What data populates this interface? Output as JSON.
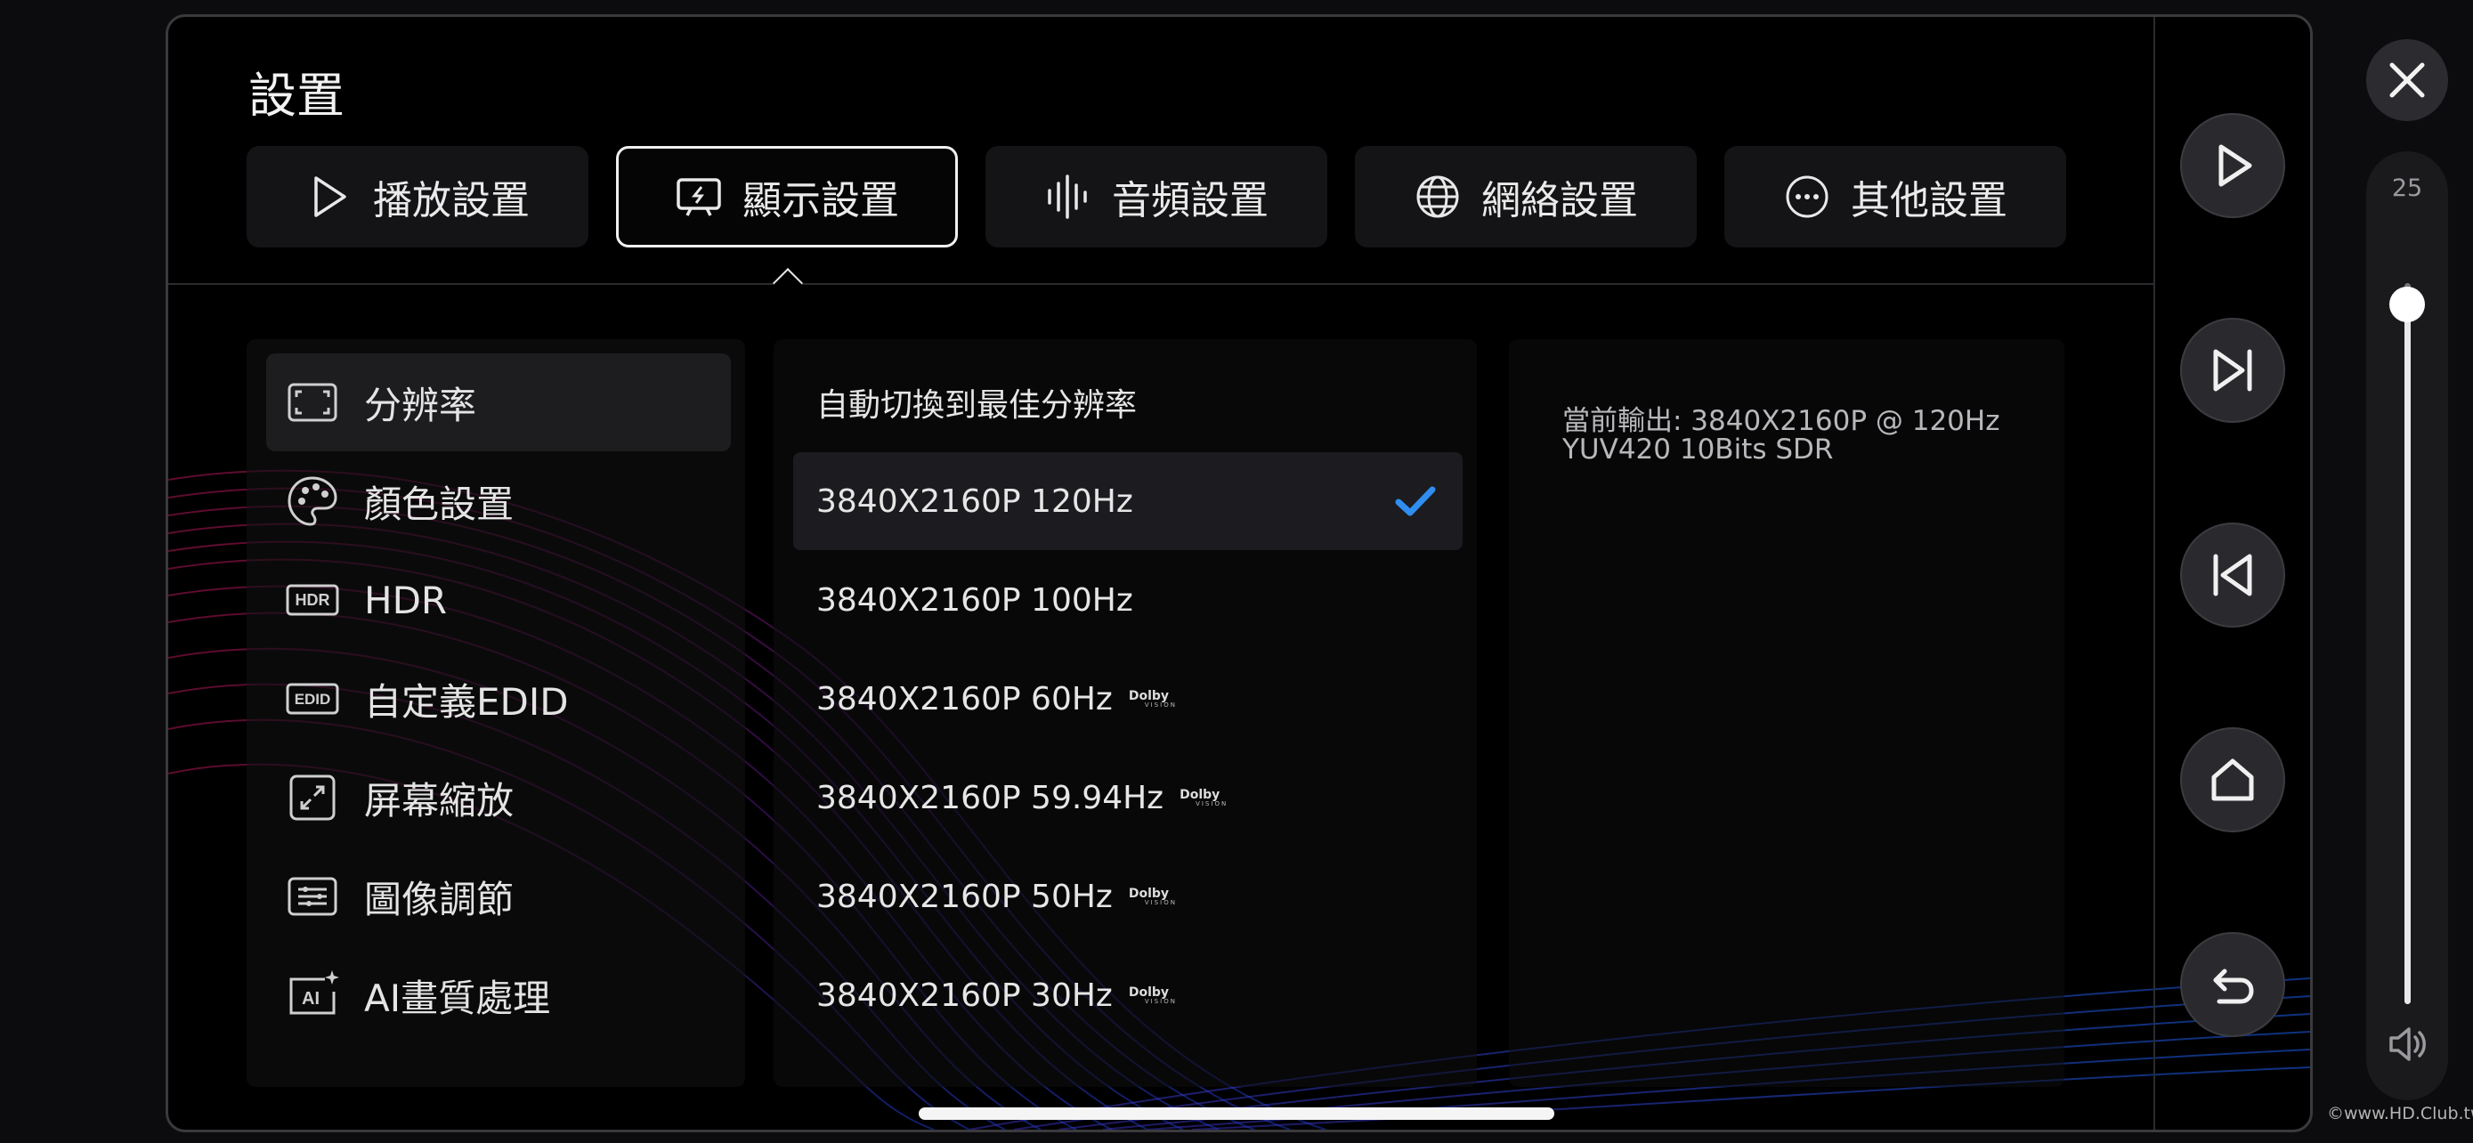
{
  "header": {
    "title": "設置"
  },
  "tabs": [
    {
      "label": "播放設置",
      "icon": "play-icon",
      "active": false
    },
    {
      "label": "顯示設置",
      "icon": "display-icon",
      "active": true
    },
    {
      "label": "音頻設置",
      "icon": "audio-wave-icon",
      "active": false
    },
    {
      "label": "網絡設置",
      "icon": "globe-icon",
      "active": false
    },
    {
      "label": "其他設置",
      "icon": "more-icon",
      "active": false
    }
  ],
  "menu": [
    {
      "label": "分辨率",
      "icon": "resolution-icon",
      "selected": true
    },
    {
      "label": "顏色設置",
      "icon": "palette-icon",
      "selected": false
    },
    {
      "label": "HDR",
      "icon": "hdr-icon",
      "icon_text": "HDR",
      "selected": false
    },
    {
      "label": "自定義EDID",
      "icon": "edid-icon",
      "icon_text": "EDID",
      "selected": false
    },
    {
      "label": "屏幕縮放",
      "icon": "zoom-icon",
      "selected": false
    },
    {
      "label": "圖像調節",
      "icon": "adjust-icon",
      "selected": false
    },
    {
      "label": "AI畫質處理",
      "icon": "ai-icon",
      "icon_text": "AI",
      "selected": false
    }
  ],
  "resolutions": [
    {
      "label": "自動切換到最佳分辨率",
      "dolby": false,
      "selected": false
    },
    {
      "label": "3840X2160P 120Hz",
      "dolby": false,
      "selected": true
    },
    {
      "label": "3840X2160P 100Hz",
      "dolby": false,
      "selected": false
    },
    {
      "label": "3840X2160P 60Hz",
      "dolby": true,
      "selected": false
    },
    {
      "label": "3840X2160P 59.94Hz",
      "dolby": true,
      "selected": false
    },
    {
      "label": "3840X2160P 50Hz",
      "dolby": true,
      "selected": false
    },
    {
      "label": "3840X2160P 30Hz",
      "dolby": true,
      "selected": false
    }
  ],
  "dolby_badge": {
    "line1": "Dolby",
    "line2": "VISION"
  },
  "info": {
    "line1": "當前輸出: 3840X2160P @ 120Hz",
    "line2": "YUV420 10Bits SDR"
  },
  "controls": [
    "play-icon",
    "skip-next-icon",
    "skip-previous-icon",
    "home-icon",
    "back-icon"
  ],
  "volume": {
    "value": "25",
    "level": 0.97
  },
  "colors": {
    "accent_check": "#2f8ef0",
    "background": "#000000"
  },
  "watermark": "©www.HD.Club.tw"
}
